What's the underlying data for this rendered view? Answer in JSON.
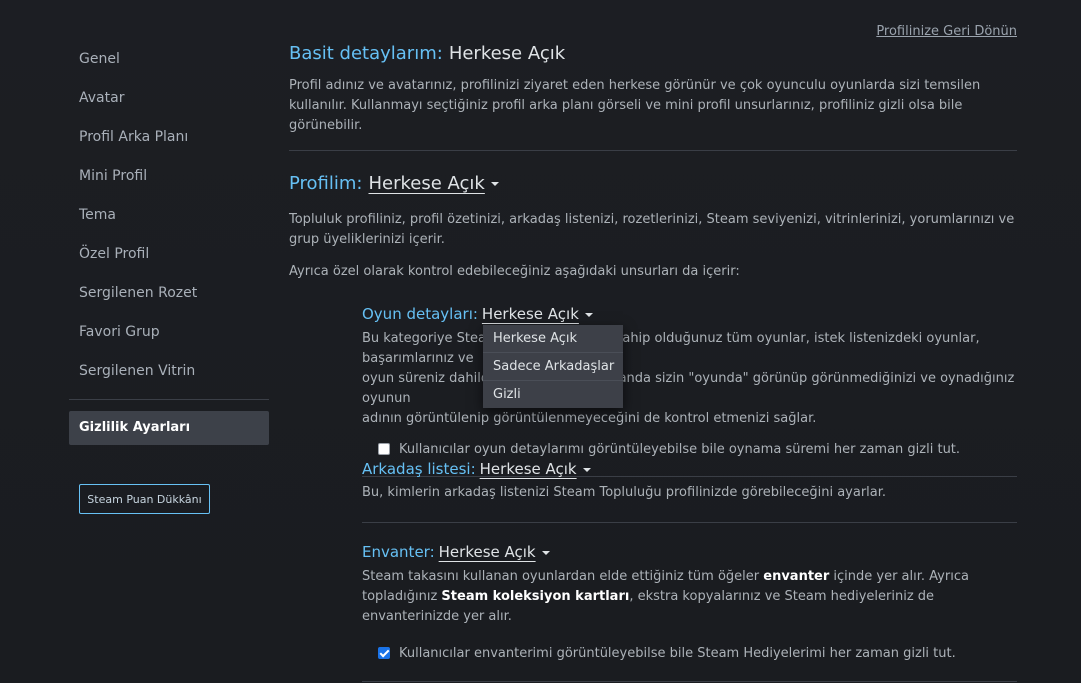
{
  "header": {
    "back_link": "Profilinize Geri Dönün"
  },
  "sidebar": {
    "items": [
      {
        "label": "Genel"
      },
      {
        "label": "Avatar"
      },
      {
        "label": "Profil Arka Planı"
      },
      {
        "label": "Mini Profil"
      },
      {
        "label": "Tema"
      },
      {
        "label": "Özel Profil"
      },
      {
        "label": "Sergilenen Rozet"
      },
      {
        "label": "Favori Grup"
      },
      {
        "label": "Sergilenen Vitrin"
      }
    ],
    "active_item": "Gizlilik Ayarları",
    "points_button": "Steam Puan Dükkânı"
  },
  "basic": {
    "label": "Basit detaylarım:",
    "value": "Herkese Açık",
    "description": "Profil adınız ve avatarınız, profilinizi ziyaret eden herkese görünür ve çok oyunculu oyunlarda sizi temsilen kullanılır. Kullanmayı seçtiğiniz profil arka planı görseli ve mini profil unsurlarınız, profiliniz gizli olsa bile görünebilir."
  },
  "profile": {
    "label": "Profilim:",
    "value": "Herkese Açık",
    "description": "Topluluk profiliniz, profil özetinizi, arkadaş listenizi, rozetlerinizi, Steam seviyenizi, vitrinlerinizi, yorumlarınızı ve grup üyeliklerinizi içerir.",
    "extra": "Ayrıca özel olarak kontrol edebileceğiniz aşağıdaki unsurları da içerir:"
  },
  "game_details": {
    "label": "Oyun detayları:",
    "value": "Herkese Açık",
    "description_lines": [
      "Bu kategoriye Steam'deki hesabınızda sahip olduğunuz tüm oyunlar, istek listenizdeki oyunlar, başarımlarınız ve",
      "oyun süreniz dahildir. Bu ayar aynı zamanda sizin \"oyunda\" görünüp görünmediğinizi ve oynadığınız oyunun",
      "adının görüntülenip görüntülenmeyeceğini de kontrol etmenizi sağlar."
    ],
    "checkbox": "Kullanıcılar oyun detaylarımı görüntüleyebilse bile oynama süremi her zaman gizli tut.",
    "checked": false
  },
  "dropdown": {
    "options": [
      "Herkese Açık",
      "Sadece Arkadaşlar",
      "Gizli"
    ]
  },
  "friends": {
    "label": "Arkadaş listesi:",
    "value": "Herkese Açık",
    "description": "Bu, kimlerin arkadaş listenizi Steam Topluluğu profilinizde görebileceğini ayarlar."
  },
  "inventory": {
    "label": "Envanter:",
    "value": "Herkese Açık",
    "desc_a": "Steam takasını kullanan oyunlardan elde ettiğiniz tüm öğeler ",
    "desc_b": "envanter",
    "desc_c": " içinde yer alır. Ayrıca topladığınız ",
    "desc_d": "Steam koleksiyon kartları",
    "desc_e": ", ekstra kopyalarınız ve Steam hediyeleriniz de envanterinizde yer alır.",
    "checkbox": "Kullanıcılar envanterimi görüntüleyebilse bile Steam Hediyelerimi her zaman gizli tut.",
    "checked": true
  },
  "colors": {
    "accent": "#66c0f4",
    "background": "#1b1d22"
  }
}
